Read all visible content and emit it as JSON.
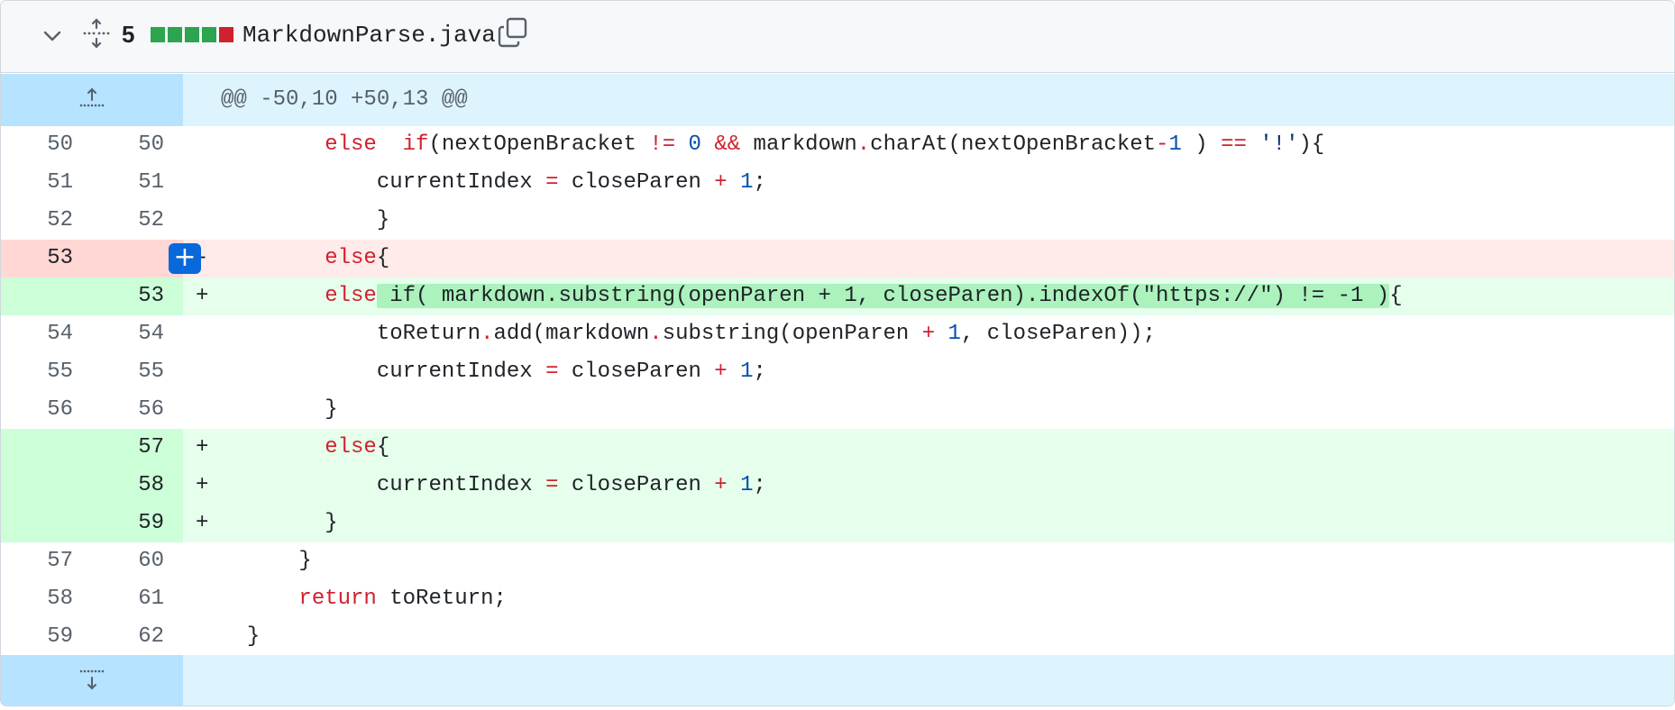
{
  "file": {
    "changes": "5",
    "name": "MarkdownParse.java",
    "diffstat": [
      "#2da44e",
      "#2da44e",
      "#2da44e",
      "#2da44e",
      "#cf222e"
    ]
  },
  "hunk_header": "@@ -50,10 +50,13 @@",
  "add_comment_glyph": "+",
  "lines": [
    {
      "type": "ctx",
      "old": "50",
      "new": "50",
      "marker": "",
      "indent": "        ",
      "tokens": [
        [
          "kw",
          "else"
        ],
        [
          "",
          "  "
        ],
        [
          "kw",
          "if"
        ],
        [
          "",
          "(nextOpenBracket "
        ],
        [
          "op",
          "!="
        ],
        [
          "",
          " "
        ],
        [
          "nm",
          "0"
        ],
        [
          "",
          " "
        ],
        [
          "op",
          "&&"
        ],
        [
          "",
          " markdown"
        ],
        [
          "op",
          "."
        ],
        [
          "",
          "charAt(nextOpenBracket"
        ],
        [
          "op",
          "-"
        ],
        [
          "nm",
          "1"
        ],
        [
          "",
          " ) "
        ],
        [
          "op",
          "=="
        ],
        [
          "",
          " "
        ],
        [
          "st",
          "'!'"
        ],
        [
          "",
          ")"
        ],
        [
          "",
          "{"
        ]
      ]
    },
    {
      "type": "ctx",
      "old": "51",
      "new": "51",
      "marker": "",
      "indent": "            ",
      "tokens": [
        [
          "",
          "currentIndex "
        ],
        [
          "op",
          "="
        ],
        [
          "",
          " closeParen "
        ],
        [
          "op",
          "+"
        ],
        [
          "",
          " "
        ],
        [
          "nm",
          "1"
        ],
        [
          "",
          ";"
        ]
      ]
    },
    {
      "type": "ctx",
      "old": "52",
      "new": "52",
      "marker": "",
      "indent": "            ",
      "tokens": [
        [
          "",
          "}"
        ]
      ]
    },
    {
      "type": "del",
      "old": "53",
      "new": "",
      "marker": "-",
      "indent": "        ",
      "tokens": [
        [
          "kw",
          "else"
        ],
        [
          "",
          "{"
        ]
      ]
    },
    {
      "type": "add",
      "old": "",
      "new": "53",
      "marker": "+",
      "indent": "        ",
      "tokens": [
        [
          "kw",
          "else"
        ],
        [
          "hl",
          " if( markdown.substring(openParen + 1, closeParen).indexOf(\"https://\") != -1 )"
        ],
        [
          "",
          "{"
        ]
      ]
    },
    {
      "type": "ctx",
      "old": "54",
      "new": "54",
      "marker": "",
      "indent": "            ",
      "tokens": [
        [
          "",
          "toReturn"
        ],
        [
          "op",
          "."
        ],
        [
          "",
          "add(markdown"
        ],
        [
          "op",
          "."
        ],
        [
          "",
          "substring(openParen "
        ],
        [
          "op",
          "+"
        ],
        [
          "",
          " "
        ],
        [
          "nm",
          "1"
        ],
        [
          "",
          ", closeParen));"
        ]
      ]
    },
    {
      "type": "ctx",
      "old": "55",
      "new": "55",
      "marker": "",
      "indent": "            ",
      "tokens": [
        [
          "",
          "currentIndex "
        ],
        [
          "op",
          "="
        ],
        [
          "",
          " closeParen "
        ],
        [
          "op",
          "+"
        ],
        [
          "",
          " "
        ],
        [
          "nm",
          "1"
        ],
        [
          "",
          ";"
        ]
      ]
    },
    {
      "type": "ctx",
      "old": "56",
      "new": "56",
      "marker": "",
      "indent": "        ",
      "tokens": [
        [
          "",
          "}"
        ]
      ]
    },
    {
      "type": "add",
      "old": "",
      "new": "57",
      "marker": "+",
      "indent": "        ",
      "tokens": [
        [
          "kw",
          "else"
        ],
        [
          "",
          "{"
        ]
      ]
    },
    {
      "type": "add",
      "old": "",
      "new": "58",
      "marker": "+",
      "indent": "            ",
      "tokens": [
        [
          "",
          "currentIndex "
        ],
        [
          "op",
          "="
        ],
        [
          "",
          " closeParen "
        ],
        [
          "op",
          "+"
        ],
        [
          "",
          " "
        ],
        [
          "nm",
          "1"
        ],
        [
          "",
          ";"
        ]
      ]
    },
    {
      "type": "add",
      "old": "",
      "new": "59",
      "marker": "+",
      "indent": "        ",
      "tokens": [
        [
          "",
          "}"
        ]
      ]
    },
    {
      "type": "ctx",
      "old": "57",
      "new": "60",
      "marker": "",
      "indent": "      ",
      "tokens": [
        [
          "",
          "}"
        ]
      ]
    },
    {
      "type": "ctx",
      "old": "58",
      "new": "61",
      "marker": "",
      "indent": "      ",
      "tokens": [
        [
          "kw",
          "return"
        ],
        [
          "",
          " toReturn;"
        ]
      ]
    },
    {
      "type": "ctx",
      "old": "59",
      "new": "62",
      "marker": "",
      "indent": "  ",
      "tokens": [
        [
          "",
          "}"
        ]
      ]
    }
  ]
}
